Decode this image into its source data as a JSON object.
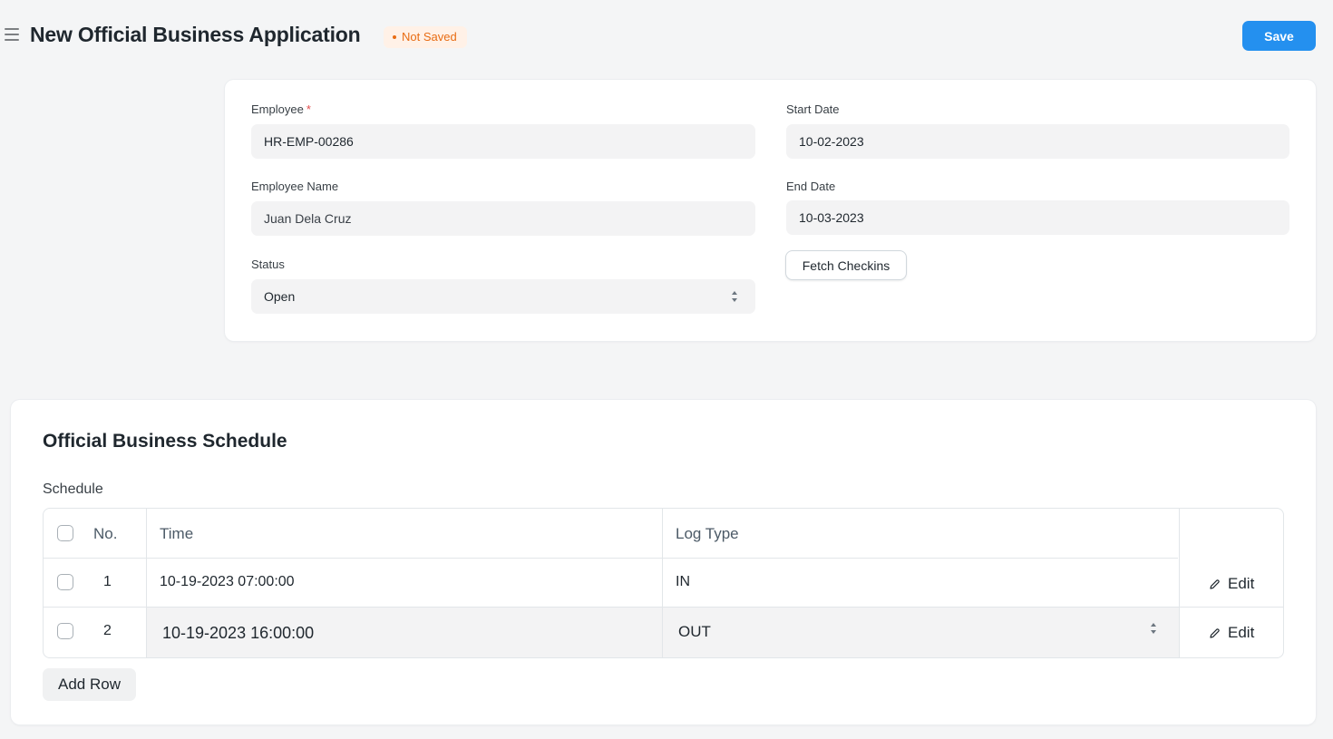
{
  "header": {
    "title": "New Official Business Application",
    "status": "Not Saved",
    "save_label": "Save"
  },
  "colors": {
    "primary": "#2490ef",
    "not_saved_text": "#e86c13",
    "not_saved_bg": "#fff1e7",
    "required_mark": "#e24c4c"
  },
  "form": {
    "employee": {
      "label": "Employee",
      "required_mark": "*",
      "value": "HR-EMP-00286"
    },
    "employee_name": {
      "label": "Employee Name",
      "value": "Juan Dela Cruz"
    },
    "status": {
      "label": "Status",
      "value": "Open"
    },
    "start_date": {
      "label": "Start Date",
      "value": "10-02-2023"
    },
    "end_date": {
      "label": "End Date",
      "value": "10-03-2023"
    },
    "fetch_checkins_label": "Fetch Checkins"
  },
  "schedule_section": {
    "title": "Official Business Schedule",
    "table_label": "Schedule",
    "columns": {
      "no": "No.",
      "time": "Time",
      "log_type": "Log Type"
    },
    "rows": [
      {
        "no": "1",
        "time": "10-19-2023 07:00:00",
        "log_type": "IN",
        "edit": "Edit"
      },
      {
        "no": "2",
        "time": "10-19-2023 16:00:00",
        "log_type": "OUT",
        "edit": "Edit"
      }
    ],
    "add_row_label": "Add Row"
  }
}
